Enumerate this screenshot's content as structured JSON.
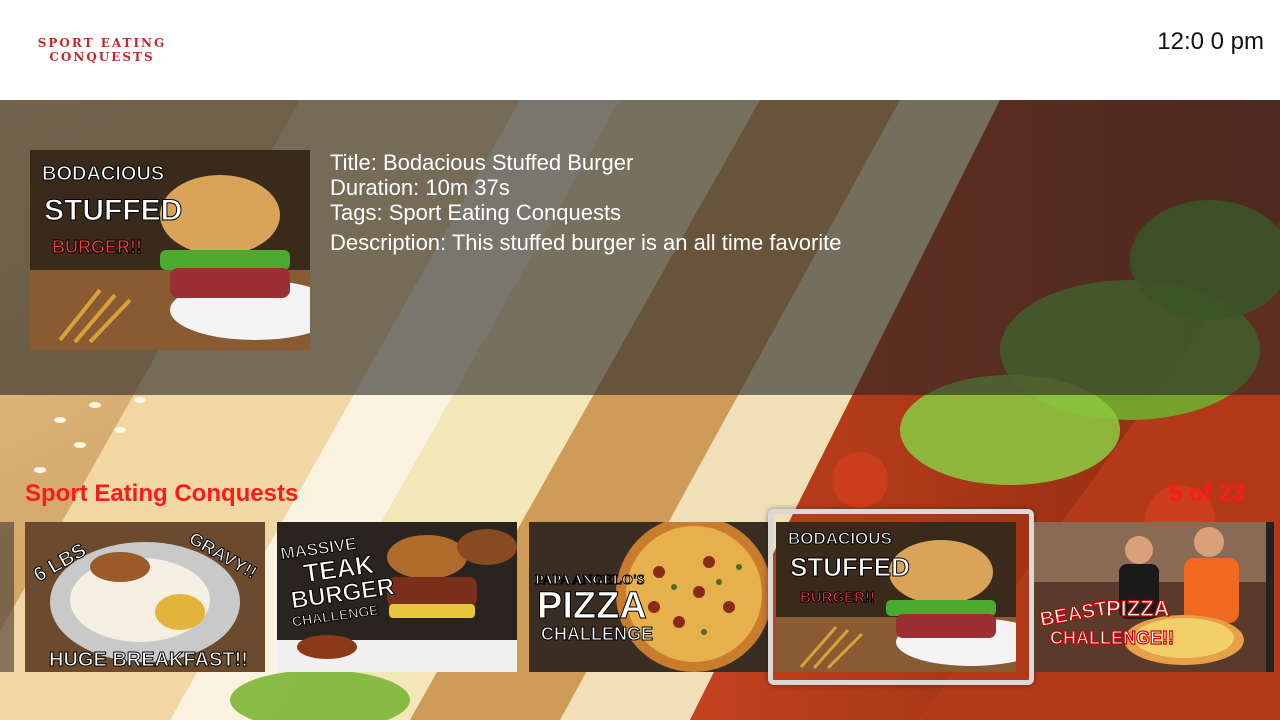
{
  "header": {
    "logo_line1": "Sport Eating",
    "logo_line2": "Conquests",
    "clock": "12:0 0 pm"
  },
  "selected": {
    "title": "Title: Bodacious Stuffed Burger",
    "duration": "Duration:  10m 37s",
    "tags": "Tags: Sport Eating Conquests",
    "description": "Description: This stuffed burger is an all time favorite",
    "thumb_text": [
      "BODACIOUS",
      "STUFFED",
      "BURGER!!"
    ]
  },
  "row": {
    "title": "Sport Eating Conquests",
    "counter": "5 of 23",
    "tiles": [
      {
        "text": [
          "6 LBS",
          "GRAVY!!",
          "HUGE BREAKFAST!!"
        ]
      },
      {
        "text": [
          "MASSIVE",
          "TEAK",
          "BURGER",
          "CHALLENGE"
        ]
      },
      {
        "text": [
          "PAPA ANGELO'S",
          "PIZZA",
          "CHALLENGE"
        ]
      },
      {
        "text": [
          "BODACIOUS",
          "STUFFED",
          "BURGER!!"
        ]
      },
      {
        "text": [
          "BEAST",
          "PIZZA",
          "CHALLENGE!!"
        ]
      }
    ]
  },
  "colors": {
    "accent": "#ff1a1a",
    "logo": "#c62828",
    "focus": "#d9d9d9"
  }
}
